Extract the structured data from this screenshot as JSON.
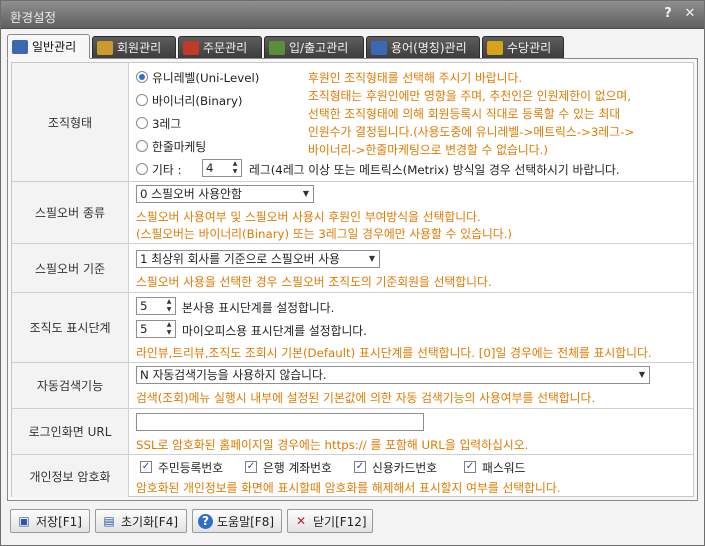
{
  "window": {
    "title": "환경설정",
    "help_glyph": "?",
    "close_glyph": "✕"
  },
  "tabs": [
    {
      "label": "일반관리",
      "icon": "wrench-icon",
      "color": "#3b67b3"
    },
    {
      "label": "회원관리",
      "icon": "users-icon",
      "color": "#c99a2e"
    },
    {
      "label": "주문관리",
      "icon": "order-icon",
      "color": "#c0392b"
    },
    {
      "label": "입/출고관리",
      "icon": "warehouse-icon",
      "color": "#5b8d3a"
    },
    {
      "label": "용어(명칭)관리",
      "icon": "terms-icon",
      "color": "#3b67b3"
    },
    {
      "label": "수당관리",
      "icon": "coins-icon",
      "color": "#d8a31a"
    }
  ],
  "org": {
    "label": "조직형태",
    "options": [
      "유니레벨(Uni-Level)",
      "바이너리(Binary)",
      "3레그",
      "한줄마케팅"
    ],
    "other_prefix": "기타 :",
    "other_value": "4",
    "other_suffix": "레그(4레그 이상 또는 메트릭스(Metrix) 방식일 경우 선택하시기 바랍니다.",
    "notes": [
      "후원인 조직형태를 선택해 주시기 바랍니다.",
      "조직형태는 후원인에만 영향을 주며, 추천인은 인원제한이 없으며,",
      "선택한 조직형태에 의해 회원등록시 직대로 등록할 수 있는 최대",
      "인원수가 결정됩니다.(사용도중에 유니레벨->메트릭스->3레그->",
      "바이너리->한줄마케팅으로 변경할 수 없습니다.)"
    ]
  },
  "spill_type": {
    "label": "스필오버 종류",
    "selected": "0 스필오버 사용안함",
    "notes": [
      "스필오버 사용여부 및 스필오버 사용시 후원인 부여방식을 선택합니다.",
      "(스필오버는 바이너리(Binary) 또는 3레그일 경우에만 사용할 수 있습니다.)"
    ]
  },
  "spill_base": {
    "label": "스필오버 기준",
    "selected": "1 최상위 회사를 기준으로 스필오버 사용",
    "note": "스필오버 사용을 선택한 경우 스필오버 조직도의 기준회원을 선택합니다."
  },
  "tree_levels": {
    "label": "조직도 표시단계",
    "main_value": "5",
    "main_text": "본사용 표시단계를 설정합니다.",
    "my_value": "5",
    "my_text": "마이오피스용 표시단계를 설정합니다.",
    "note": "라인뷰,트리뷰,조직도 조회시 기본(Default) 표시단계를 선택합니다. [0]일 경우에는 전체를 표시합니다."
  },
  "auto_search": {
    "label": "자동검색기능",
    "selected": "N 자동검색기능을 사용하지 않습니다.",
    "note": "검색(조회)메뉴 실행시 내부에 설정된 기본값에 의한 자동 검색기능의 사용여부를 선택합니다."
  },
  "login_url": {
    "label": "로그인화면 URL",
    "value": "",
    "note": "SSL로 암호화된 홈페이지일 경우에는 https:// 를 포함해 URL을 입력하십시오."
  },
  "privacy": {
    "label": "개인정보 암호화",
    "items": [
      "주민등록번호",
      "은행 계좌번호",
      "신용카드번호",
      "패스워드"
    ],
    "note": "암호화된 개인정보를 화면에 표시할때 암호화를 해제해서 표시할지 여부를 선택합니다."
  },
  "footer": {
    "save": "저장[F1]",
    "reset": "초기화[F4]",
    "help": "도움말[F8]",
    "close": "닫기[F12]"
  }
}
